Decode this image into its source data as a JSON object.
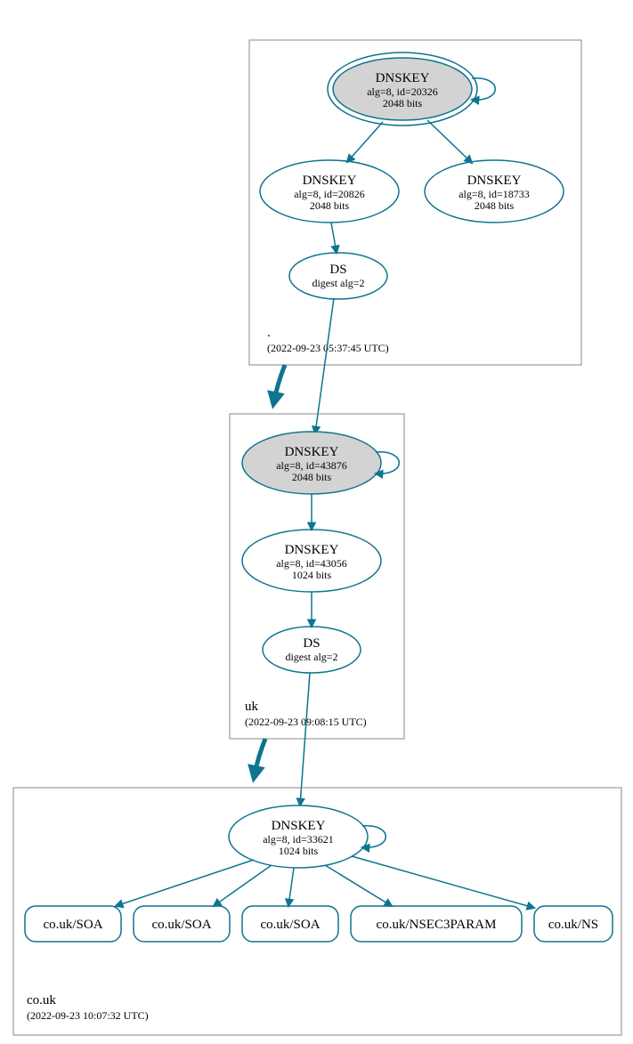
{
  "colors": {
    "stroke": "#0e7490",
    "keyfill": "#d3d3d3"
  },
  "zones": {
    "root": {
      "label": ".",
      "time": "(2022-09-23 05:37:45 UTC)",
      "nodes": {
        "ksk": {
          "title": "DNSKEY",
          "l2": "alg=8, id=20326",
          "l3": "2048 bits"
        },
        "zsk1": {
          "title": "DNSKEY",
          "l2": "alg=8, id=20826",
          "l3": "2048 bits"
        },
        "zsk2": {
          "title": "DNSKEY",
          "l2": "alg=8, id=18733",
          "l3": "2048 bits"
        },
        "ds": {
          "title": "DS",
          "l2": "digest alg=2"
        }
      }
    },
    "uk": {
      "label": "uk",
      "time": "(2022-09-23 09:08:15 UTC)",
      "nodes": {
        "ksk": {
          "title": "DNSKEY",
          "l2": "alg=8, id=43876",
          "l3": "2048 bits"
        },
        "zsk": {
          "title": "DNSKEY",
          "l2": "alg=8, id=43056",
          "l3": "1024 bits"
        },
        "ds": {
          "title": "DS",
          "l2": "digest alg=2"
        }
      }
    },
    "couk": {
      "label": "co.uk",
      "time": "(2022-09-23 10:07:32 UTC)",
      "nodes": {
        "zsk": {
          "title": "DNSKEY",
          "l2": "alg=8, id=33621",
          "l3": "1024 bits"
        }
      },
      "rrs": {
        "soa1": "co.uk/SOA",
        "soa2": "co.uk/SOA",
        "soa3": "co.uk/SOA",
        "nsec3": "co.uk/NSEC3PARAM",
        "ns": "co.uk/NS"
      }
    }
  }
}
